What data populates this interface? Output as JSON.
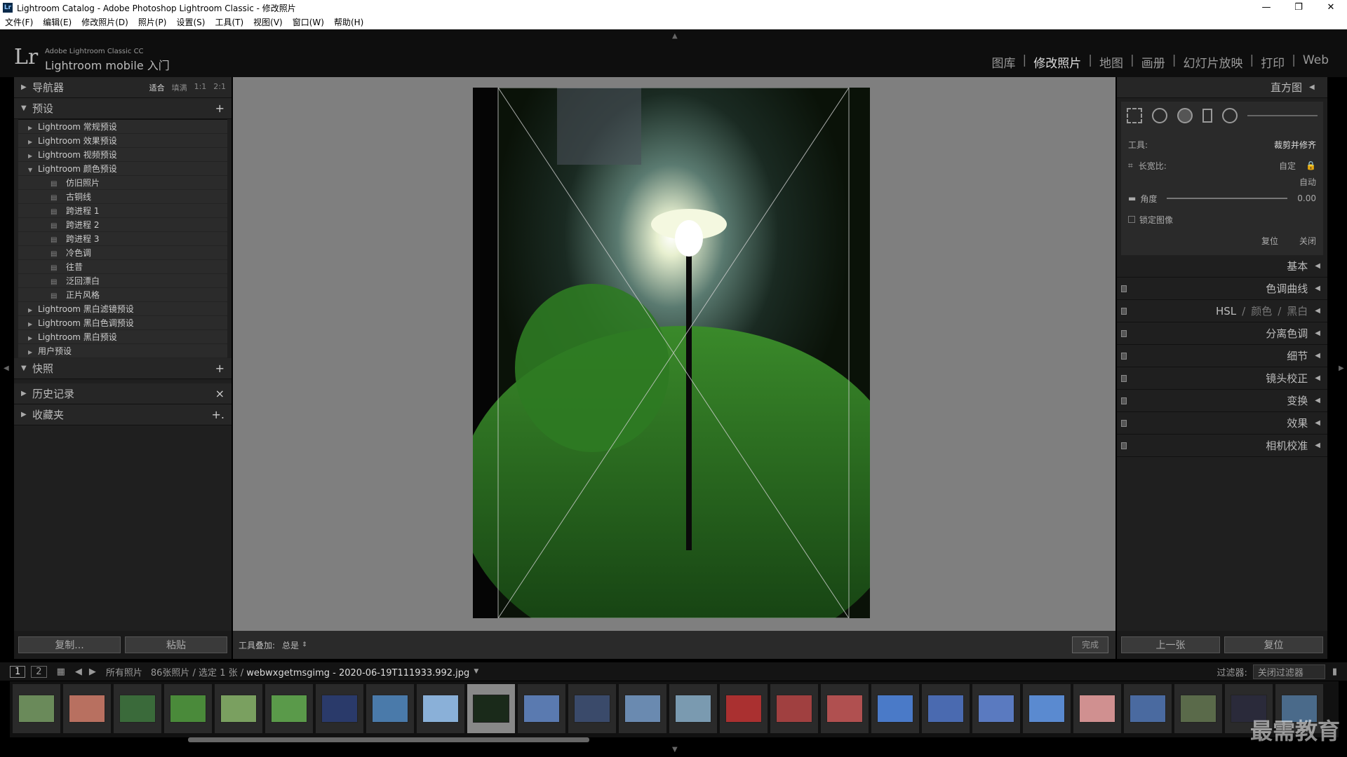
{
  "window": {
    "title": "Lightroom Catalog - Adobe Photoshop Lightroom Classic - 修改照片",
    "app_icon": "Lr"
  },
  "menu": [
    "文件(F)",
    "编辑(E)",
    "修改照片(D)",
    "照片(P)",
    "设置(S)",
    "工具(T)",
    "视图(V)",
    "窗口(W)",
    "帮助(H)"
  ],
  "identity": {
    "logo": "Lr",
    "line1": "Adobe Lightroom Classic CC",
    "line2": "Lightroom mobile 入门"
  },
  "modules": [
    "图库",
    "修改照片",
    "地图",
    "画册",
    "幻灯片放映",
    "打印",
    "Web"
  ],
  "left": {
    "navigator": {
      "label": "导航器",
      "zoom": [
        "适合",
        "填满",
        "1:1",
        "2:1"
      ]
    },
    "presets": {
      "label": "预设",
      "plus": "+",
      "items": [
        {
          "label": "Lightroom 常规预设",
          "open": false
        },
        {
          "label": "Lightroom 效果预设",
          "open": false
        },
        {
          "label": "Lightroom 视频预设",
          "open": false
        },
        {
          "label": "Lightroom 颜色预设",
          "open": true,
          "children": [
            "仿旧照片",
            "古铜线",
            "跨进程 1",
            "跨进程 2",
            "跨进程 3",
            "冷色调",
            "往昔",
            "泛回漂白",
            "正片风格"
          ]
        },
        {
          "label": "Lightroom 黑白滤镜预设",
          "open": false
        },
        {
          "label": "Lightroom 黑白色调预设",
          "open": false
        },
        {
          "label": "Lightroom 黑白预设",
          "open": false
        },
        {
          "label": "用户预设",
          "open": false
        }
      ]
    },
    "snapshots": {
      "label": "快照",
      "plus": "+"
    },
    "history": {
      "label": "历史记录",
      "x": "×"
    },
    "collections": {
      "label": "收藏夹",
      "plus": "+."
    },
    "buttons": {
      "copy": "复制...",
      "paste": "粘贴"
    }
  },
  "toolbar": {
    "overlay_label": "工具叠加:",
    "overlay_value": "总是",
    "done": "完成"
  },
  "right": {
    "histogram": "直方图",
    "crop": {
      "tool_label": "工具:",
      "tool_value": "裁剪并修齐",
      "aspect_label": "长宽比:",
      "aspect_value": "自定",
      "auto": "自动",
      "angle_label": "角度",
      "angle_value": "0.00",
      "lock_label": "锁定图像",
      "reset": "复位",
      "close": "关闭"
    },
    "sections": [
      "基本",
      "色调曲线",
      "分离色调",
      "细节",
      "镜头校正",
      "变换",
      "效果",
      "相机校准"
    ],
    "hsl": {
      "a": "HSL",
      "b": "颜色",
      "c": "黑白",
      "sep": "/"
    },
    "buttons": {
      "prev": "上一张",
      "reset": "复位"
    }
  },
  "filmstrip_bar": {
    "page1": "1",
    "page2": "2",
    "source": "所有照片",
    "count": "86张照片 / 选定 1 张 /",
    "filename": "webwxgetmsgimg - 2020-06-19T111933.992.jpg",
    "filter_label": "过滤器:",
    "filter_value": "关闭过滤器"
  },
  "watermark": "最需教育",
  "colors": {
    "accent_thumb": [
      "#6a8a5a",
      "#b87060",
      "#3a6a3a",
      "#4a8a3a",
      "#7aa060",
      "#5a9a4a",
      "#2a3a6a",
      "#4a7aaa",
      "#8ab0d8",
      "#1a2a1a",
      "#5a7ab0",
      "#3a4a6a",
      "#6a8ab0",
      "#7a9ab0",
      "#aa3030",
      "#a04040",
      "#b05050",
      "#4a7ac8",
      "#4a6ab0",
      "#5a7ac0",
      "#5a8ad0",
      "#d09090",
      "#4a6aa0",
      "#5a6a4a",
      "#2a2a3a",
      "#4a6a8a"
    ]
  }
}
